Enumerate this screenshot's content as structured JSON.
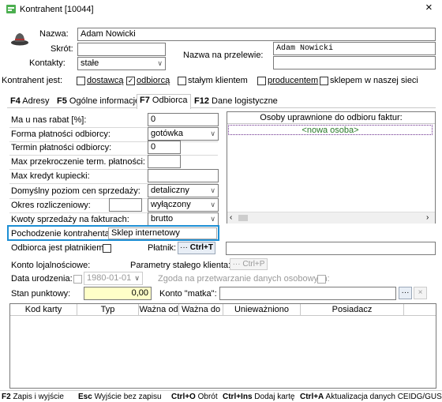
{
  "window": {
    "title": "Kontrahent [10044]",
    "close": "×"
  },
  "header": {
    "name_label": "Nazwa:",
    "name_value": "Adam Nowicki",
    "short_label": "Skrót:",
    "short_value": "",
    "contacts_label": "Kontakty:",
    "contacts_value": "stałe",
    "transfer_label": "Nazwa na przelewie:",
    "transfer_line1": "Adam Nowicki",
    "transfer_line2": ""
  },
  "roles": {
    "label": "Kontrahent jest:",
    "items": [
      {
        "label": "dostawcą",
        "checked": false
      },
      {
        "label": "odbiorcą",
        "checked": true
      },
      {
        "label": "stałym klientem",
        "checked": false
      },
      {
        "label": "producentem",
        "checked": false
      },
      {
        "label": "sklepem w naszej sieci",
        "checked": false
      }
    ]
  },
  "tabs": [
    {
      "key": "F4",
      "label": "Adresy"
    },
    {
      "key": "F5",
      "label": "Ogólne informacje"
    },
    {
      "key": "F7",
      "label": "Odbiorca"
    },
    {
      "key": "F12",
      "label": "Dane logistyczne"
    }
  ],
  "form": {
    "discount_label": "Ma u nas rabat [%]:",
    "discount_value": "0",
    "payment_label": "Forma płatności odbiorcy:",
    "payment_value": "gotówka",
    "term_label": "Termin płatności odbiorcy:",
    "term_value": "0",
    "max_overdue_label": "Max przekroczenie term. płatności:",
    "max_overdue_value": "",
    "max_credit_label": "Max kredyt kupiecki:",
    "max_credit_value": "",
    "price_level_label": "Domyślny poziom cen sprzedaży:",
    "price_level_value": "detaliczny",
    "period_label": "Okres rozliczeniowy:",
    "period_value": "wyłączony",
    "period_small_value": "",
    "amounts_label": "Kwoty sprzedaży na fakturach:",
    "amounts_value": "brutto",
    "origin_label": "Pochodzenie kontrahenta:",
    "origin_value": "Sklep internetowy",
    "payer_check_label": "Odbiorca jest płatnikiem:",
    "payer_label": "Płatnik:",
    "payer_btn": "Ctrl+T",
    "payer_value": ""
  },
  "persons": {
    "header": "Osoby uprawnione do odbioru faktur:",
    "new_person": "<nowa osoba>"
  },
  "loyalty": {
    "card_label": "Konto lojalnościowe:",
    "params_label": "Parametry stałego klienta:",
    "params_btn": "Ctrl+P",
    "birth_label": "Data urodzenia:",
    "birth_value": "1980-01-01",
    "consent_label": "Zgoda na przetwarzanie danych osobowych:",
    "points_label": "Stan punktowy:",
    "points_value": "0,00",
    "parent_label": "Konto \"matka\":",
    "parent_value": ""
  },
  "table": {
    "columns": [
      "Kod karty",
      "Typ",
      "Ważna od",
      "Ważna do",
      "Unieważniono",
      "Posiadacz"
    ]
  },
  "footer": [
    {
      "key": "F2",
      "label": "Zapis i wyjście"
    },
    {
      "key": "Esc",
      "label": "Wyjście bez zapisu"
    },
    {
      "key": "Ctrl+O",
      "label": "Obrót"
    },
    {
      "key": "Ctrl+Ins",
      "label": "Dodaj kartę"
    },
    {
      "key": "Ctrl+A",
      "label": "Aktualizacja danych CEIDG/GUS"
    }
  ],
  "colors": {
    "highlight": "#1e8fd4",
    "accent": "#6a2c8c",
    "yellow": "#ffffc8",
    "tab_active": "#ffffff"
  },
  "icons": {
    "app": "app-icon",
    "contractor": "hat-icon"
  }
}
